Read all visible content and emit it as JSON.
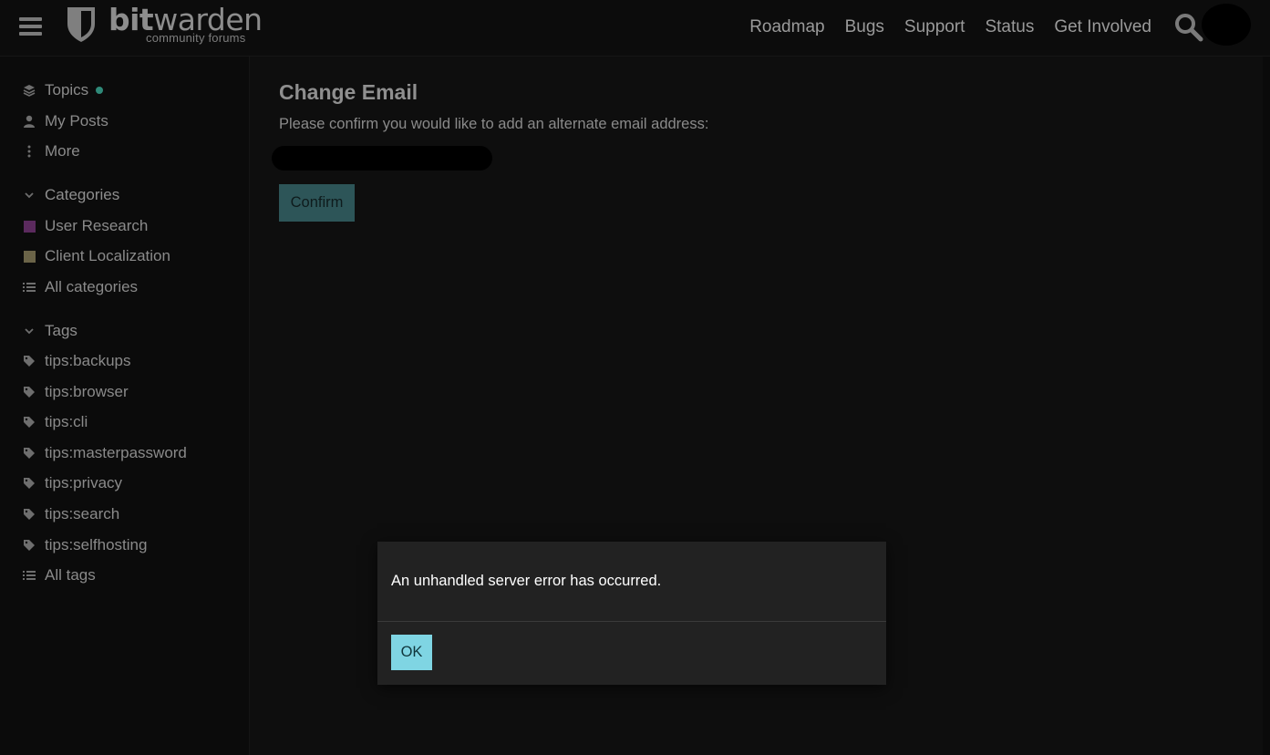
{
  "header": {
    "logo_bold": "bit",
    "logo_rest": "warden",
    "logo_sub": "community forums",
    "nav": [
      "Roadmap",
      "Bugs",
      "Support",
      "Status",
      "Get Involved"
    ]
  },
  "sidebar": {
    "items": [
      {
        "label": "Topics",
        "icon": "layers-icon"
      },
      {
        "label": "My Posts",
        "icon": "user-icon"
      },
      {
        "label": "More",
        "icon": "vertical-ellipsis-icon"
      }
    ],
    "categories_heading": "Categories",
    "categories": [
      {
        "label": "User Research",
        "color": "#5b2a5e"
      },
      {
        "label": "Client Localization",
        "color": "#6b6448"
      },
      {
        "label": "All categories",
        "icon": "list-icon"
      }
    ],
    "tags_heading": "Tags",
    "tags": [
      "tips:backups",
      "tips:browser",
      "tips:cli",
      "tips:masterpassword",
      "tips:privacy",
      "tips:search",
      "tips:selfhosting"
    ],
    "all_tags": "All tags",
    "accent_dot_color": "#2f8a79"
  },
  "main": {
    "title": "Change Email",
    "description": "Please confirm you would like to add an alternate email address:",
    "confirm_label": "Confirm"
  },
  "modal": {
    "message": "An unhandled server error has occurred.",
    "ok_label": "OK"
  }
}
